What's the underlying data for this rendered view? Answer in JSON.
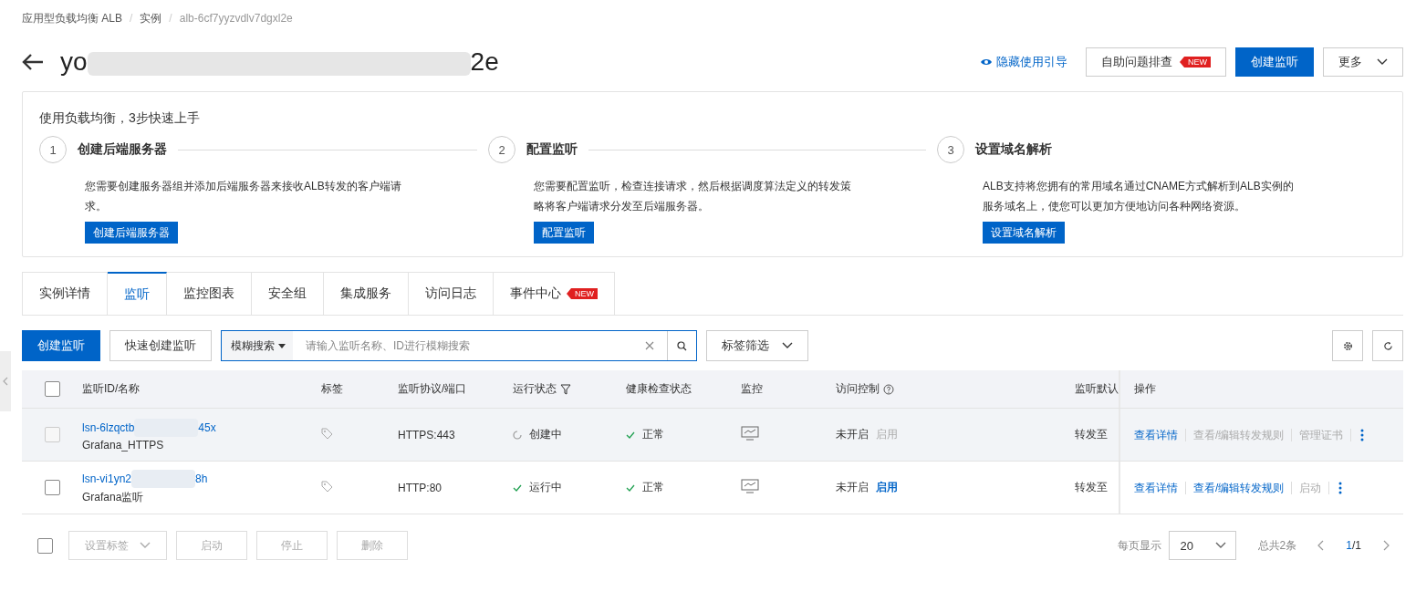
{
  "breadcrumb": [
    {
      "label": "应用型负载均衡 ALB",
      "current": false
    },
    {
      "separator": "/",
      "label": "实例",
      "current": false
    },
    {
      "separator": "/",
      "label": "alb-6cf7yyzvdlv7dgxl2e",
      "current": true
    }
  ],
  "header": {
    "title_start": "yo",
    "title_end": "2e",
    "guide_link": "隐藏使用引导",
    "buttons": [
      {
        "kind": "default",
        "label": "自助问题排查",
        "badge": "NEW"
      },
      {
        "kind": "primary",
        "label": "创建监听"
      },
      {
        "kind": "dropdown",
        "label": "更多"
      }
    ]
  },
  "guide": {
    "title": "使用负载均衡，3步快速上手",
    "steps": [
      {
        "number": "1",
        "title": "创建后端服务器",
        "description": "您需要创建服务器组并添加后端服务器来接收ALB转发的客户端请求。",
        "button": "创建后端服务器"
      },
      {
        "number": "2",
        "title": "配置监听",
        "description": "您需要配置监听，检查连接请求，然后根据调度算法定义的转发策略将客户端请求分发至后端服务器。",
        "button": "配置监听"
      },
      {
        "number": "3",
        "title": "设置域名解析",
        "description": "ALB支持将您拥有的常用域名通过CNAME方式解析到ALB实例的服务域名上，使您可以更加方便地访问各种网络资源。",
        "button": "设置域名解析"
      }
    ]
  },
  "tabs": [
    {
      "label": "实例详情",
      "selected": false
    },
    {
      "label": "监听",
      "selected": true
    },
    {
      "label": "监控图表",
      "selected": false
    },
    {
      "label": "安全组",
      "selected": false
    },
    {
      "label": "集成服务",
      "selected": false
    },
    {
      "label": "访问日志",
      "selected": false
    },
    {
      "label": "事件中心",
      "selected": false,
      "badge": "NEW"
    }
  ],
  "toolbar": {
    "primary_button": "创建监听",
    "quick_button": "快速创建监听",
    "search_mode": "模糊搜索",
    "search_placeholder": "请输入监听名称、ID进行模糊搜索",
    "tag_filter": "标签筛选"
  },
  "table": {
    "select_all_checked": false,
    "columns": [
      "监听ID/名称",
      "标签",
      "监听协议/端口",
      "运行状态",
      "健康检查状态",
      "监控",
      "访问控制",
      "监听默认",
      "操作"
    ],
    "rows": [
      {
        "id_start": "lsn-6lzqctb",
        "id_end": "45x",
        "name": "Grafana_HTTPS",
        "checked": false,
        "disabled": true,
        "highlighted": true,
        "protocol": "HTTPS:443",
        "status": {
          "kind": "creating",
          "label": "创建中"
        },
        "health": {
          "kind": "ok",
          "label": "正常"
        },
        "access": {
          "label": "未开启",
          "action": "启用",
          "action_disabled": true
        },
        "default_action": "转发至",
        "actions": [
          {
            "label": "查看详情",
            "disabled": false
          },
          {
            "label": "查看/编辑转发规则",
            "disabled": true
          },
          {
            "label": "管理证书",
            "disabled": true
          }
        ]
      },
      {
        "id_start": "lsn-vi1yn2",
        "id_end": "8h",
        "name": "Grafana监听",
        "checked": false,
        "disabled": false,
        "highlighted": false,
        "protocol": "HTTP:80",
        "status": {
          "kind": "running",
          "label": "运行中"
        },
        "health": {
          "kind": "ok",
          "label": "正常"
        },
        "access": {
          "label": "未开启",
          "action": "启用",
          "action_disabled": false
        },
        "default_action": "转发至",
        "actions": [
          {
            "label": "查看详情",
            "disabled": false
          },
          {
            "label": "查看/编辑转发规则",
            "disabled": false
          },
          {
            "label": "启动",
            "disabled": true
          }
        ]
      }
    ]
  },
  "footer": {
    "select_all_checked": false,
    "bulk_buttons": [
      {
        "label": "设置标签",
        "kind": "dropdown",
        "disabled": true
      },
      {
        "label": "启动",
        "kind": "plain",
        "disabled": true
      },
      {
        "label": "停止",
        "kind": "plain",
        "disabled": true
      },
      {
        "label": "删除",
        "kind": "plain",
        "disabled": true
      }
    ],
    "page_size_label": "每页显示",
    "page_size": "20",
    "total": "总共2条",
    "page_current": "1",
    "page_total": "/1"
  }
}
